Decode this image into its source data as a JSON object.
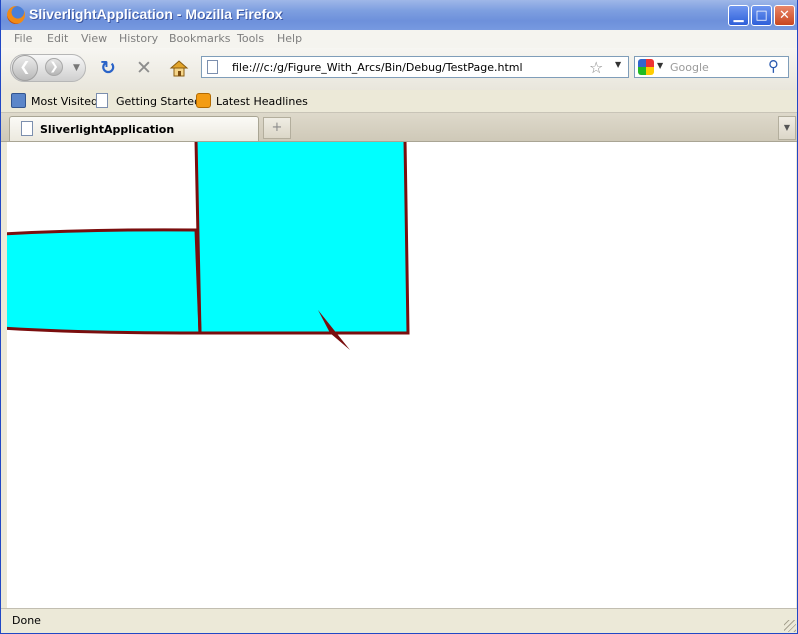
{
  "window": {
    "title": "SliverlightApplication - Mozilla Firefox"
  },
  "menu": [
    "File",
    "Edit",
    "View",
    "History",
    "Bookmarks",
    "Tools",
    "Help"
  ],
  "nav": {
    "url": "file:///c:/g/Figure_With_Arcs/Bin/Debug/TestPage.html",
    "search_placeholder": "Google"
  },
  "bookmarks": [
    "Most Visited",
    "Getting Started",
    "Latest Headlines"
  ],
  "tabs": [
    {
      "label": "SliverlightApplication"
    }
  ],
  "status": {
    "text": "Done"
  },
  "figure": {
    "fill": "#00ffff",
    "stroke": "#7a0e0e"
  },
  "icons": {
    "app": "firefox-logo-icon",
    "back": "back-arrow-icon",
    "forward": "forward-arrow-icon",
    "reload": "reload-icon",
    "stop": "stop-icon",
    "home": "home-icon",
    "bookmark_star": "star-icon",
    "search": "magnifier-icon"
  }
}
